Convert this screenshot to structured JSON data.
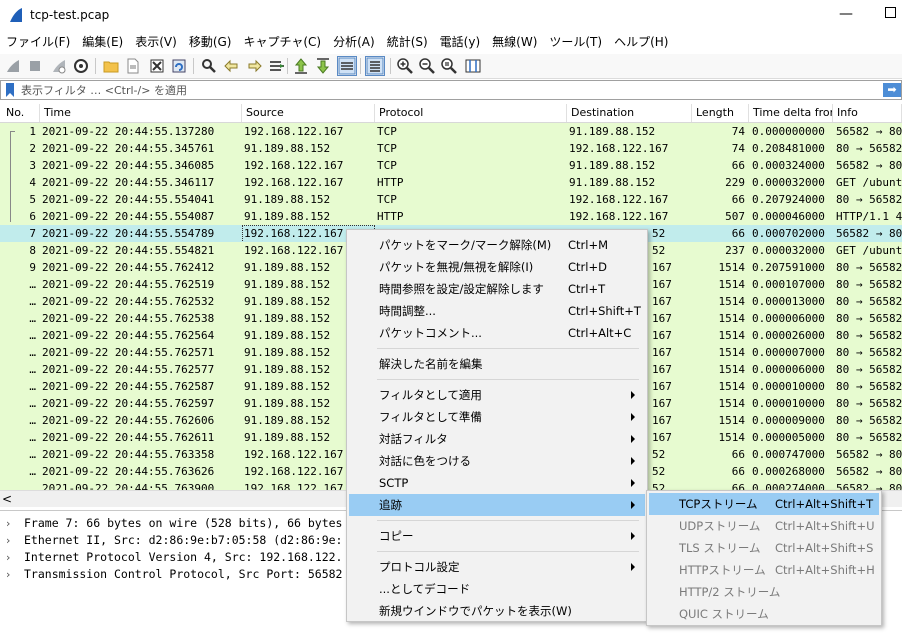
{
  "window": {
    "title": "tcp-test.pcap",
    "minimize_glyph": "—"
  },
  "menubar": [
    "ファイル(F)",
    "編集(E)",
    "表示(V)",
    "移動(G)",
    "キャプチャ(C)",
    "分析(A)",
    "統計(S)",
    "電話(y)",
    "無線(W)",
    "ツール(T)",
    "ヘルプ(H)"
  ],
  "toolbar": {
    "icons": [
      "shark-fin-start-icon",
      "stop-icon",
      "restart-icon",
      "options-gear-icon",
      "open-folder-icon",
      "file-icon",
      "close-file-icon",
      "reload-icon",
      "search-icon",
      "back-arrow-icon",
      "forward-arrow-icon",
      "go-to-packet-icon",
      "first-packet-icon",
      "last-packet-icon",
      "autoscroll-icon",
      "colorize-icon",
      "zoom-in-icon",
      "zoom-out-icon",
      "zoom-reset-icon",
      "resize-columns-icon"
    ]
  },
  "filter": {
    "placeholder": "表示フィルタ … <Ctrl-/> を適用",
    "apply_glyph": "➡"
  },
  "columns": [
    "No.",
    "Time",
    "Source",
    "Protocol",
    "Destination",
    "Length",
    "Time delta fron",
    "Info"
  ],
  "rows": [
    {
      "no": "1",
      "time": "2021-09-22 20:44:55.137280",
      "src": "192.168.122.167",
      "proto": "TCP",
      "dst": "91.189.88.152",
      "len": "74",
      "delta": "0.000000000",
      "info": "56582 → 80"
    },
    {
      "no": "2",
      "time": "2021-09-22 20:44:55.345761",
      "src": "91.189.88.152",
      "proto": "TCP",
      "dst": "192.168.122.167",
      "len": "74",
      "delta": "0.208481000",
      "info": "80 → 56582"
    },
    {
      "no": "3",
      "time": "2021-09-22 20:44:55.346085",
      "src": "192.168.122.167",
      "proto": "TCP",
      "dst": "91.189.88.152",
      "len": "66",
      "delta": "0.000324000",
      "info": "56582 → 80"
    },
    {
      "no": "4",
      "time": "2021-09-22 20:44:55.346117",
      "src": "192.168.122.167",
      "proto": "HTTP",
      "dst": "91.189.88.152",
      "len": "229",
      "delta": "0.000032000",
      "info": "GET /ubunt"
    },
    {
      "no": "5",
      "time": "2021-09-22 20:44:55.554041",
      "src": "91.189.88.152",
      "proto": "TCP",
      "dst": "192.168.122.167",
      "len": "66",
      "delta": "0.207924000",
      "info": "80 → 56582"
    },
    {
      "no": "6",
      "time": "2021-09-22 20:44:55.554087",
      "src": "91.189.88.152",
      "proto": "HTTP",
      "dst": "192.168.122.167",
      "len": "507",
      "delta": "0.000046000",
      "info": "HTTP/1.1 4"
    },
    {
      "no": "7",
      "time": "2021-09-22 20:44:55.554789",
      "src": "192.168.122.167",
      "proto": "",
      "dst": "52",
      "len": "66",
      "delta": "0.000702000",
      "info": "56582 → 80"
    },
    {
      "no": "8",
      "time": "2021-09-22 20:44:55.554821",
      "src": "192.168.122.167",
      "proto": "",
      "dst": "52",
      "len": "237",
      "delta": "0.000032000",
      "info": "GET /ubunt"
    },
    {
      "no": "9",
      "time": "2021-09-22 20:44:55.762412",
      "src": "91.189.88.152",
      "proto": "",
      "dst": "167",
      "len": "1514",
      "delta": "0.207591000",
      "info": "80 → 56582"
    },
    {
      "no": "…",
      "time": "2021-09-22 20:44:55.762519",
      "src": "91.189.88.152",
      "proto": "",
      "dst": "167",
      "len": "1514",
      "delta": "0.000107000",
      "info": "80 → 56582"
    },
    {
      "no": "…",
      "time": "2021-09-22 20:44:55.762532",
      "src": "91.189.88.152",
      "proto": "",
      "dst": "167",
      "len": "1514",
      "delta": "0.000013000",
      "info": "80 → 56582"
    },
    {
      "no": "…",
      "time": "2021-09-22 20:44:55.762538",
      "src": "91.189.88.152",
      "proto": "",
      "dst": "167",
      "len": "1514",
      "delta": "0.000006000",
      "info": "80 → 56582"
    },
    {
      "no": "…",
      "time": "2021-09-22 20:44:55.762564",
      "src": "91.189.88.152",
      "proto": "",
      "dst": "167",
      "len": "1514",
      "delta": "0.000026000",
      "info": "80 → 56582"
    },
    {
      "no": "…",
      "time": "2021-09-22 20:44:55.762571",
      "src": "91.189.88.152",
      "proto": "",
      "dst": "167",
      "len": "1514",
      "delta": "0.000007000",
      "info": "80 → 56582"
    },
    {
      "no": "…",
      "time": "2021-09-22 20:44:55.762577",
      "src": "91.189.88.152",
      "proto": "",
      "dst": "167",
      "len": "1514",
      "delta": "0.000006000",
      "info": "80 → 56582"
    },
    {
      "no": "…",
      "time": "2021-09-22 20:44:55.762587",
      "src": "91.189.88.152",
      "proto": "",
      "dst": "167",
      "len": "1514",
      "delta": "0.000010000",
      "info": "80 → 56582"
    },
    {
      "no": "…",
      "time": "2021-09-22 20:44:55.762597",
      "src": "91.189.88.152",
      "proto": "",
      "dst": "167",
      "len": "1514",
      "delta": "0.000010000",
      "info": "80 → 56582"
    },
    {
      "no": "…",
      "time": "2021-09-22 20:44:55.762606",
      "src": "91.189.88.152",
      "proto": "",
      "dst": "167",
      "len": "1514",
      "delta": "0.000009000",
      "info": "80 → 56582"
    },
    {
      "no": "…",
      "time": "2021-09-22 20:44:55.762611",
      "src": "91.189.88.152",
      "proto": "",
      "dst": "167",
      "len": "1514",
      "delta": "0.000005000",
      "info": "80 → 56582"
    },
    {
      "no": "…",
      "time": "2021-09-22 20:44:55.763358",
      "src": "192.168.122.167",
      "proto": "",
      "dst": "52",
      "len": "66",
      "delta": "0.000747000",
      "info": "56582 → 80"
    },
    {
      "no": "…",
      "time": "2021-09-22 20:44:55.763626",
      "src": "192.168.122.167",
      "proto": "",
      "dst": "52",
      "len": "66",
      "delta": "0.000268000",
      "info": "56582 → 80"
    },
    {
      "no": "…",
      "time": "2021-09-22 20:44:55.763900",
      "src": "192.168.122.167",
      "proto": "",
      "dst": "52",
      "len": "66",
      "delta": "0.000274000",
      "info": "56582 → 80"
    }
  ],
  "details": [
    "Frame 7: 66 bytes on wire (528 bits), 66 bytes",
    "Ethernet II, Src: d2:86:9e:b7:05:58 (d2:86:9e:",
    "Internet Protocol Version 4, Src: 192.168.122.",
    "Transmission Control Protocol, Src Port: 56582"
  ],
  "context_menu": [
    {
      "label": "パケットをマーク/マーク解除(M)",
      "shortcut": "Ctrl+M"
    },
    {
      "label": "パケットを無視/無視を解除(I)",
      "shortcut": "Ctrl+D"
    },
    {
      "label": "時間参照を設定/設定解除します",
      "shortcut": "Ctrl+T"
    },
    {
      "label": "時間調整...",
      "shortcut": "Ctrl+Shift+T"
    },
    {
      "label": "パケットコメント...",
      "shortcut": "Ctrl+Alt+C"
    },
    {
      "sep": true
    },
    {
      "label": "解決した名前を編集",
      "shortcut": ""
    },
    {
      "sep": true
    },
    {
      "label": "フィルタとして適用",
      "shortcut": "",
      "submenu": true
    },
    {
      "label": "フィルタとして準備",
      "shortcut": "",
      "submenu": true
    },
    {
      "label": "対話フィルタ",
      "shortcut": "",
      "submenu": true
    },
    {
      "label": "対話に色をつける",
      "shortcut": "",
      "submenu": true
    },
    {
      "label": "SCTP",
      "shortcut": "",
      "submenu": true
    },
    {
      "label": "追跡",
      "shortcut": "",
      "submenu": true,
      "highlight": true
    },
    {
      "sep": true
    },
    {
      "label": "コピー",
      "shortcut": "",
      "submenu": true
    },
    {
      "sep": true
    },
    {
      "label": "プロトコル設定",
      "shortcut": "",
      "submenu": true
    },
    {
      "label": "...としてデコード",
      "shortcut": ""
    },
    {
      "label": "新規ウインドウでパケットを表示(W)",
      "shortcut": ""
    }
  ],
  "follow_submenu": [
    {
      "label": "TCPストリーム",
      "shortcut": "Ctrl+Alt+Shift+T",
      "enabled": true,
      "highlight": true
    },
    {
      "label": "UDPストリーム",
      "shortcut": "Ctrl+Alt+Shift+U",
      "enabled": false
    },
    {
      "label": "TLS ストリーム",
      "shortcut": "Ctrl+Alt+Shift+S",
      "enabled": false
    },
    {
      "label": "HTTPストリーム",
      "shortcut": "Ctrl+Alt+Shift+H",
      "enabled": false
    },
    {
      "label": "HTTP/2 ストリーム",
      "shortcut": "",
      "enabled": false
    },
    {
      "label": "QUIC ストリーム",
      "shortcut": "",
      "enabled": false
    }
  ],
  "colors": {
    "tcp_row": "#e7fbd0",
    "selected_row": "#c1ecec",
    "menu_highlight": "#99ccf3",
    "accent": "#2f6fc4"
  },
  "scroll_glyph": "<"
}
